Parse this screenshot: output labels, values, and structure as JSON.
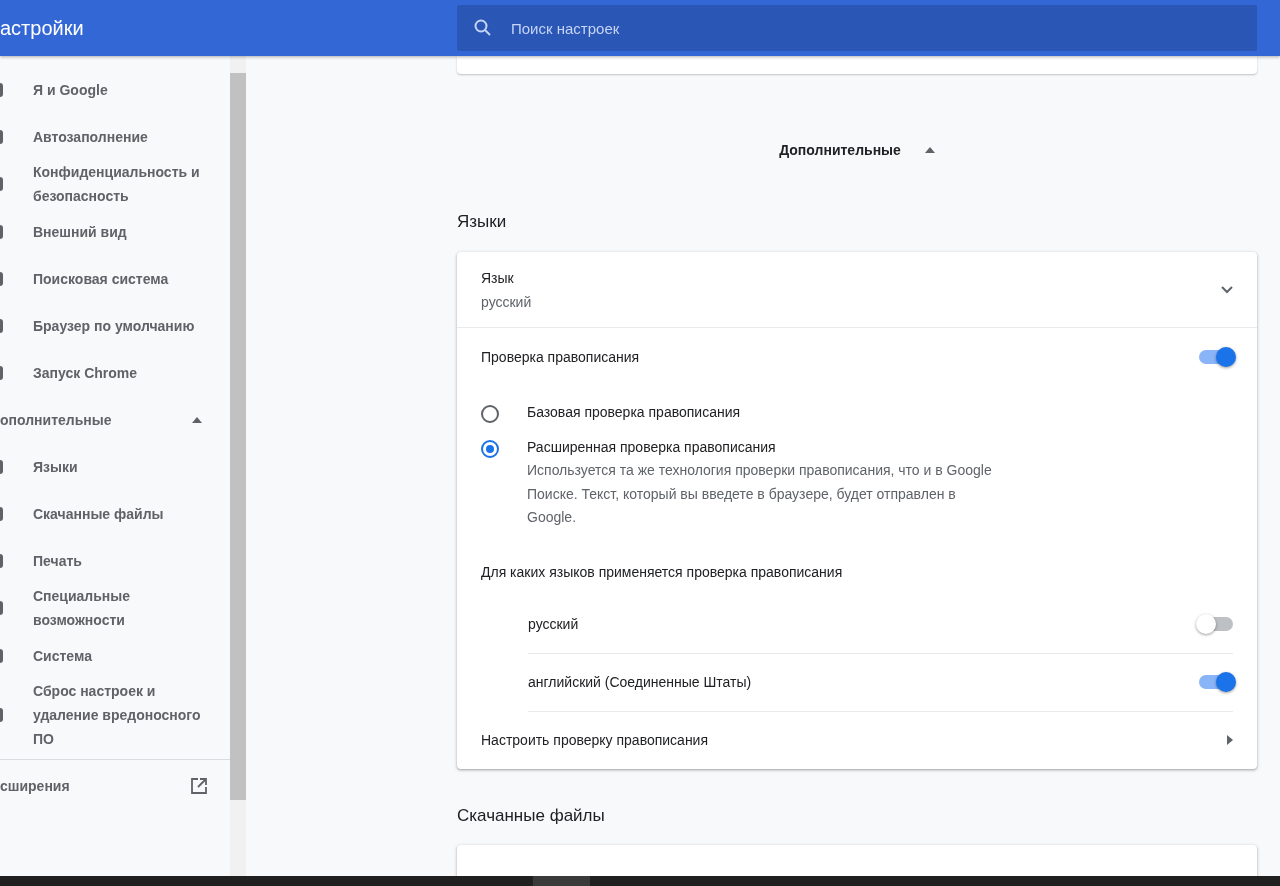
{
  "header": {
    "title": "астройки",
    "search": {
      "placeholder": "Поиск настроек"
    }
  },
  "sidebar": {
    "items": [
      {
        "label": "Я и Google"
      },
      {
        "label": "Автозаполнение"
      },
      {
        "label": "Конфиденциальность и безопасность"
      },
      {
        "label": "Внешний вид"
      },
      {
        "label": "Поисковая система"
      },
      {
        "label": "Браузер по умолчанию"
      },
      {
        "label": "Запуск Chrome"
      }
    ],
    "advanced": {
      "label": "ополнительные",
      "expanded": true,
      "items": [
        {
          "label": "Языки"
        },
        {
          "label": "Скачанные файлы"
        },
        {
          "label": "Печать"
        },
        {
          "label": "Специальные возможности"
        },
        {
          "label": "Система"
        },
        {
          "label": "Сброс настроек и удаление вредоносного ПО"
        }
      ]
    },
    "extensions": {
      "label": "сширения"
    }
  },
  "advanced_toggle": {
    "label": "Дополнительные",
    "expanded": true
  },
  "languages": {
    "heading": "Языки",
    "language": {
      "label": "Язык",
      "value": "русский"
    },
    "spellcheck": {
      "label": "Проверка правописания",
      "on": true
    },
    "options": [
      {
        "label": "Базовая проверка правописания",
        "selected": false
      },
      {
        "label": "Расширенная проверка правописания",
        "description": "Используется та же технология проверки правописания, что и в Google Поиске. Текст, который вы введете в браузере, будет отправлен в Google.",
        "selected": true
      }
    ],
    "spell_languages_heading": "Для каких языков применяется проверка правописания",
    "spell_languages": [
      {
        "label": "русский",
        "on": false
      },
      {
        "label": "английский (Соединенные Штаты)",
        "on": true
      }
    ],
    "customize": "Настроить проверку правописания"
  },
  "downloads": {
    "heading": "Скачанные файлы"
  }
}
